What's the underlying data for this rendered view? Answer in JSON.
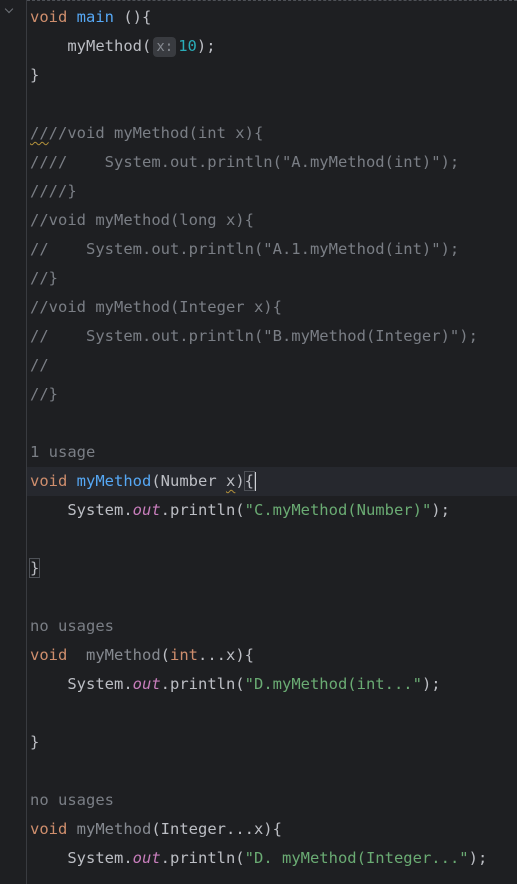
{
  "code": {
    "l1": {
      "kw": "void",
      "fn": "main",
      "rest": " (){"
    },
    "l2": {
      "indent": "    ",
      "call": "myMethod(",
      "hint": "x:",
      "num": "10",
      "end": ");"
    },
    "l3": {
      "text": "}"
    },
    "l5": {
      "squiggle": "//",
      "text": "//void myMethod(int x){"
    },
    "l6": {
      "text": "////    System.out.println(\"A.myMethod(int)\");"
    },
    "l7": {
      "text": "////}"
    },
    "l8": {
      "text": "//void myMethod(long x){"
    },
    "l9": {
      "text": "//    System.out.println(\"A.1.myMethod(int)\");"
    },
    "l10": {
      "text": "//}"
    },
    "l11": {
      "text": "//void myMethod(Integer x){"
    },
    "l12": {
      "text": "//    System.out.println(\"B.myMethod(Integer)\");"
    },
    "l13": {
      "text": "//"
    },
    "l14": {
      "text": "//}"
    },
    "u1": {
      "text": "1 usage"
    },
    "m1": {
      "kw": "void",
      "fn": "myMethod",
      "open": "(Number ",
      "param": "x",
      "close": ")",
      "brace": "{"
    },
    "m1b": {
      "indent": "    ",
      "sys": "System.",
      "out": "out",
      "mid": ".println(",
      "str": "\"C.myMethod(Number)\"",
      "end": ");"
    },
    "m1c": {
      "text": "}"
    },
    "u2": {
      "text": "no usages"
    },
    "m2": {
      "kw": "void",
      "gap": "  ",
      "fn": "myMethod",
      "open": "(",
      "kw2": "int",
      "rest": "...x){"
    },
    "m2b": {
      "indent": "    ",
      "sys": "System.",
      "out": "out",
      "mid": ".println(",
      "str": "\"D.myMethod(int...\"",
      "end": ");"
    },
    "m2c": {
      "text": "}"
    },
    "u3": {
      "text": "no usages"
    },
    "m3": {
      "kw": "void",
      "fn": "myMethod",
      "rest": "(Integer...x){"
    },
    "m3b": {
      "indent": "    ",
      "sys": "System.",
      "out": "out",
      "mid": ".println(",
      "str": "\"D. myMethod(Integer...\"",
      "end": ");"
    }
  }
}
